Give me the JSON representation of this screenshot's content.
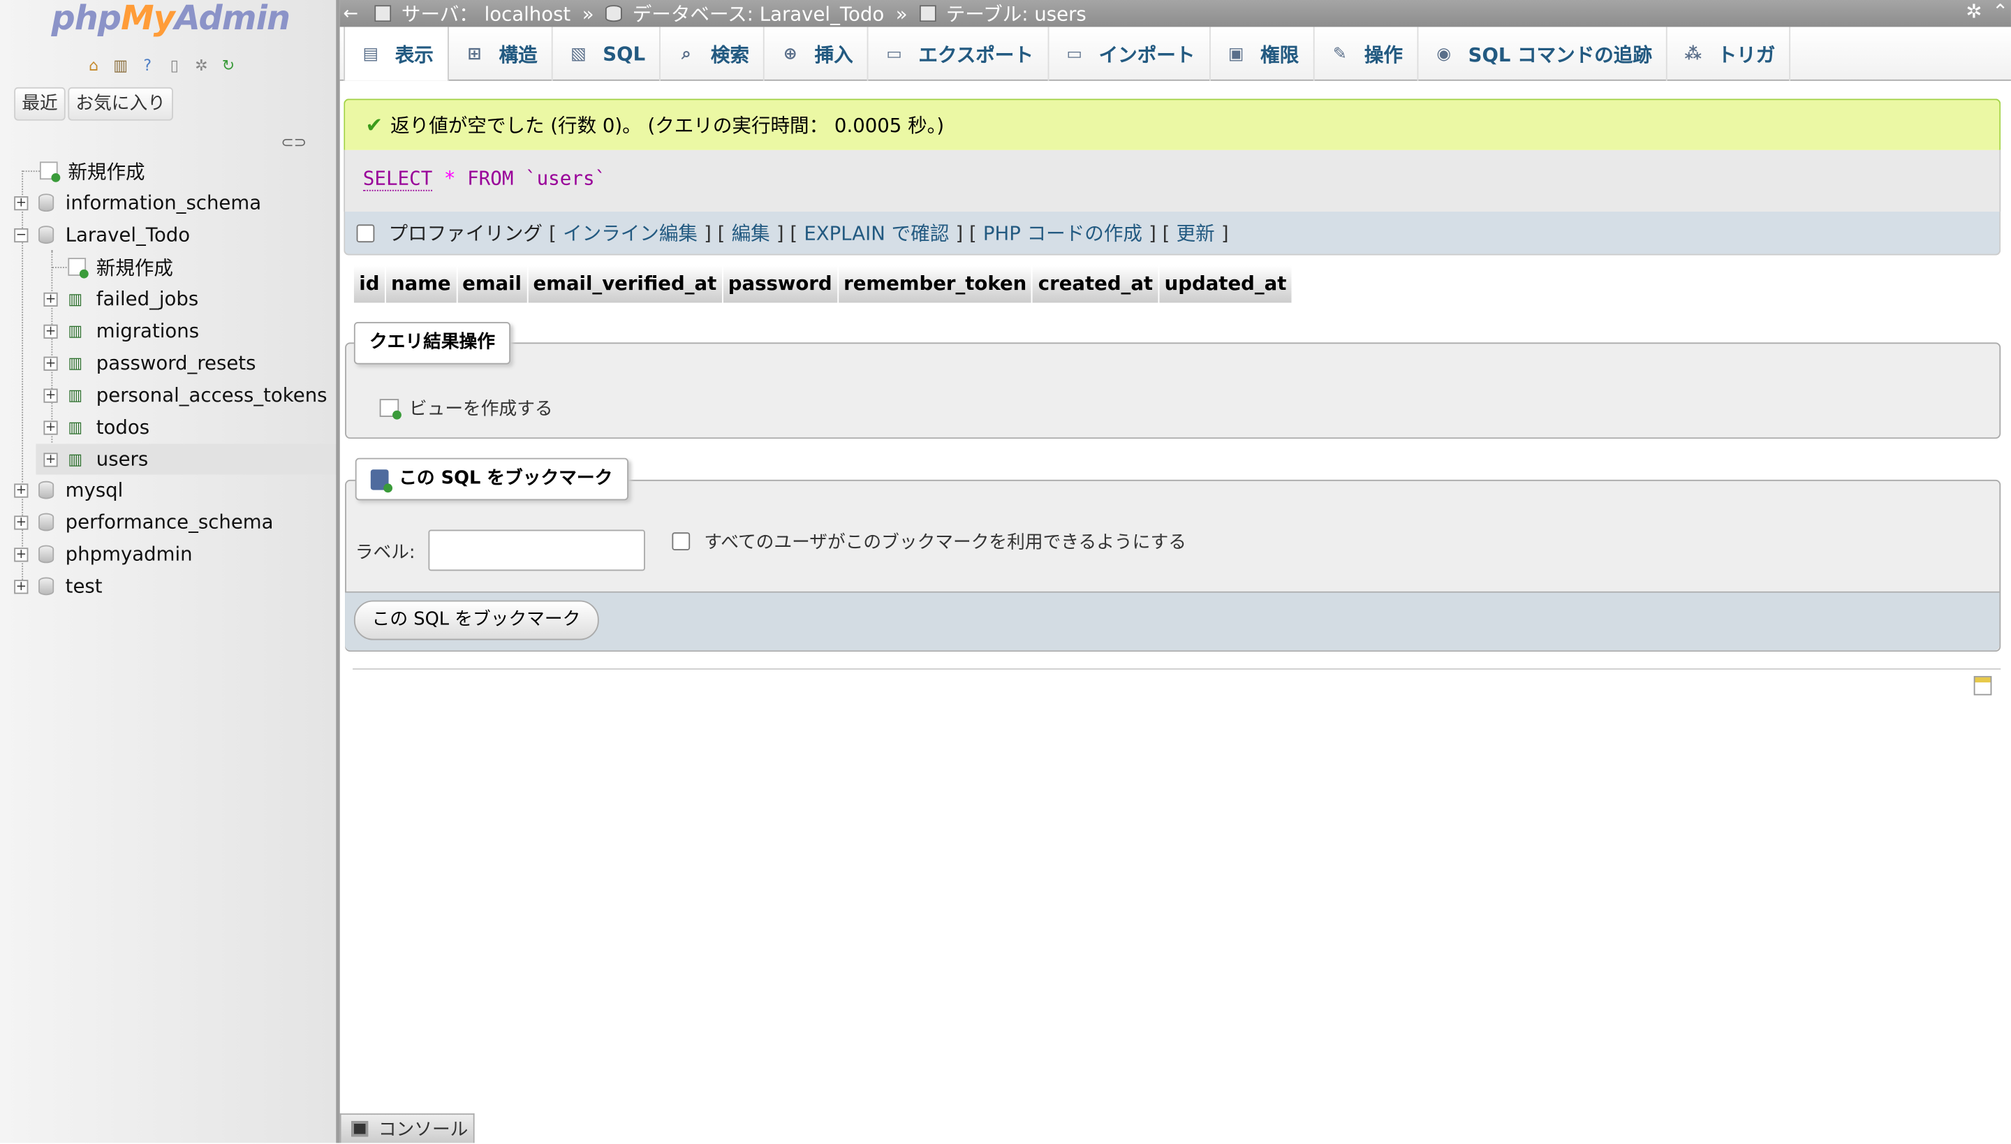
{
  "logo": {
    "php": "php",
    "my": "My",
    "admin": "Admin"
  },
  "sidebar": {
    "recent_label": "最近",
    "favorites_label": "お気に入り",
    "tree": [
      {
        "label": "新規作成",
        "type": "new"
      },
      {
        "label": "information_schema",
        "type": "db",
        "expander": "+"
      },
      {
        "label": "Laravel_Todo",
        "type": "db",
        "expander": "−"
      },
      {
        "label": "新規作成",
        "type": "new-child"
      },
      {
        "label": "failed_jobs",
        "type": "table",
        "expander": "+"
      },
      {
        "label": "migrations",
        "type": "table",
        "expander": "+"
      },
      {
        "label": "password_resets",
        "type": "table",
        "expander": "+"
      },
      {
        "label": "personal_access_tokens",
        "type": "table",
        "expander": "+"
      },
      {
        "label": "todos",
        "type": "table",
        "expander": "+"
      },
      {
        "label": "users",
        "type": "table",
        "expander": "+",
        "selected": true
      },
      {
        "label": "mysql",
        "type": "db",
        "expander": "+"
      },
      {
        "label": "performance_schema",
        "type": "db",
        "expander": "+"
      },
      {
        "label": "phpmyadmin",
        "type": "db",
        "expander": "+"
      },
      {
        "label": "test",
        "type": "db",
        "expander": "+"
      }
    ]
  },
  "breadcrumb": {
    "back": "←",
    "server": "サーバ： localhost",
    "database": "データベース: Laravel_Todo",
    "table": "テーブル: users",
    "separator": "»"
  },
  "tabs": [
    {
      "label": "表示",
      "icon": "browse-icon",
      "glyph": "▤",
      "active": true
    },
    {
      "label": "構造",
      "icon": "structure-icon",
      "glyph": "⊞"
    },
    {
      "label": "SQL",
      "icon": "sql-icon",
      "glyph": "▧"
    },
    {
      "label": "検索",
      "icon": "search-icon",
      "glyph": "⌕"
    },
    {
      "label": "挿入",
      "icon": "insert-icon",
      "glyph": "⊕"
    },
    {
      "label": "エクスポート",
      "icon": "export-icon",
      "glyph": "▭"
    },
    {
      "label": "インポート",
      "icon": "import-icon",
      "glyph": "▭"
    },
    {
      "label": "権限",
      "icon": "privileges-icon",
      "glyph": "▣"
    },
    {
      "label": "操作",
      "icon": "wrench-icon",
      "glyph": "✎"
    },
    {
      "label": "SQL コマンドの追跡",
      "icon": "eye-icon",
      "glyph": "◉"
    },
    {
      "label": "トリガ",
      "icon": "trigger-icon",
      "glyph": "⁂"
    }
  ],
  "notice": {
    "text": "返り値が空でした (行数 0)。 (クエリの実行時間： 0.0005 秒。)"
  },
  "sql": {
    "select": "SELECT",
    "star": "*",
    "from": "FROM",
    "table": "`users`"
  },
  "query_tools": {
    "profiling": "プロファイリング",
    "inline_edit": "インライン編集",
    "edit": "編集",
    "explain": "EXPLAIN で確認",
    "php_code": "PHP コードの作成",
    "refresh": "更新"
  },
  "result_columns": [
    "id",
    "name",
    "email",
    "email_verified_at",
    "password",
    "remember_token",
    "created_at",
    "updated_at"
  ],
  "query_ops": {
    "legend": "クエリ結果操作",
    "create_view": "ビューを作成する"
  },
  "bookmark": {
    "legend": "この SQL をブックマーク",
    "label_text": "ラベル:",
    "label_value": "",
    "share_text": "すべてのユーザがこのブックマークを利用できるようにする",
    "button": "この SQL をブックマーク"
  },
  "console": {
    "label": "コンソール"
  },
  "colors": {
    "link": "#235a81",
    "notice_bg": "#ebf8a4",
    "accent_orange": "#ff9c38"
  }
}
